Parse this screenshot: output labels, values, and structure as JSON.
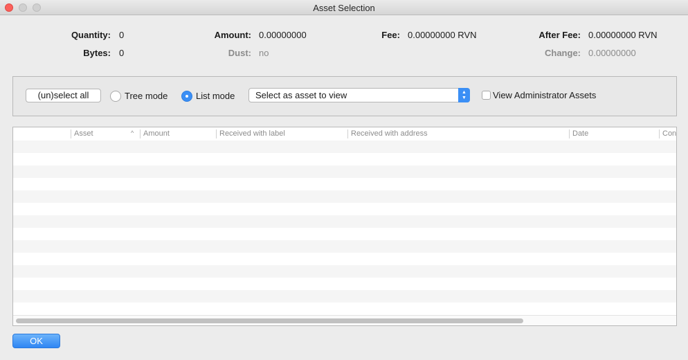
{
  "window": {
    "title": "Asset Selection"
  },
  "summary": {
    "quantity": {
      "label": "Quantity:",
      "value": "0"
    },
    "bytes": {
      "label": "Bytes:",
      "value": "0"
    },
    "amount": {
      "label": "Amount:",
      "value": "0.00000000"
    },
    "dust": {
      "label": "Dust:",
      "value": "no"
    },
    "fee": {
      "label": "Fee:",
      "value": "0.00000000 RVN"
    },
    "after_fee": {
      "label": "After Fee:",
      "value": "0.00000000 RVN"
    },
    "change": {
      "label": "Change:",
      "value": "0.00000000"
    }
  },
  "controls": {
    "unselect_all": "(un)select all",
    "tree_mode": "Tree mode",
    "list_mode": "List mode",
    "selected_mode": "list",
    "asset_select": "Select as asset to view",
    "view_admin": "View Administrator Assets",
    "view_admin_checked": false
  },
  "table": {
    "columns": [
      "Asset",
      "Amount",
      "Received with label",
      "Received with address",
      "Date",
      "Con"
    ],
    "sort_column": "Asset",
    "sort_direction": "ascending",
    "rows": []
  },
  "footer": {
    "ok_label": "OK"
  },
  "colors": {
    "accent": "#3b8ff5",
    "close": "#fc605b"
  }
}
